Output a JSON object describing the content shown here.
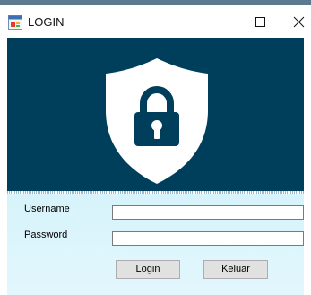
{
  "window": {
    "title": "LOGIN",
    "icon": "form-app-icon",
    "controls": [
      "minimize-icon",
      "maximize-icon",
      "close-icon"
    ]
  },
  "banner": {
    "icon": "shield-lock-icon",
    "background_color": "#003f5c",
    "icon_color": "#ffffff"
  },
  "form": {
    "username_label": "Username",
    "username_value": "",
    "password_label": "Password",
    "password_value": "",
    "login_label": "Login",
    "exit_label": "Keluar"
  }
}
